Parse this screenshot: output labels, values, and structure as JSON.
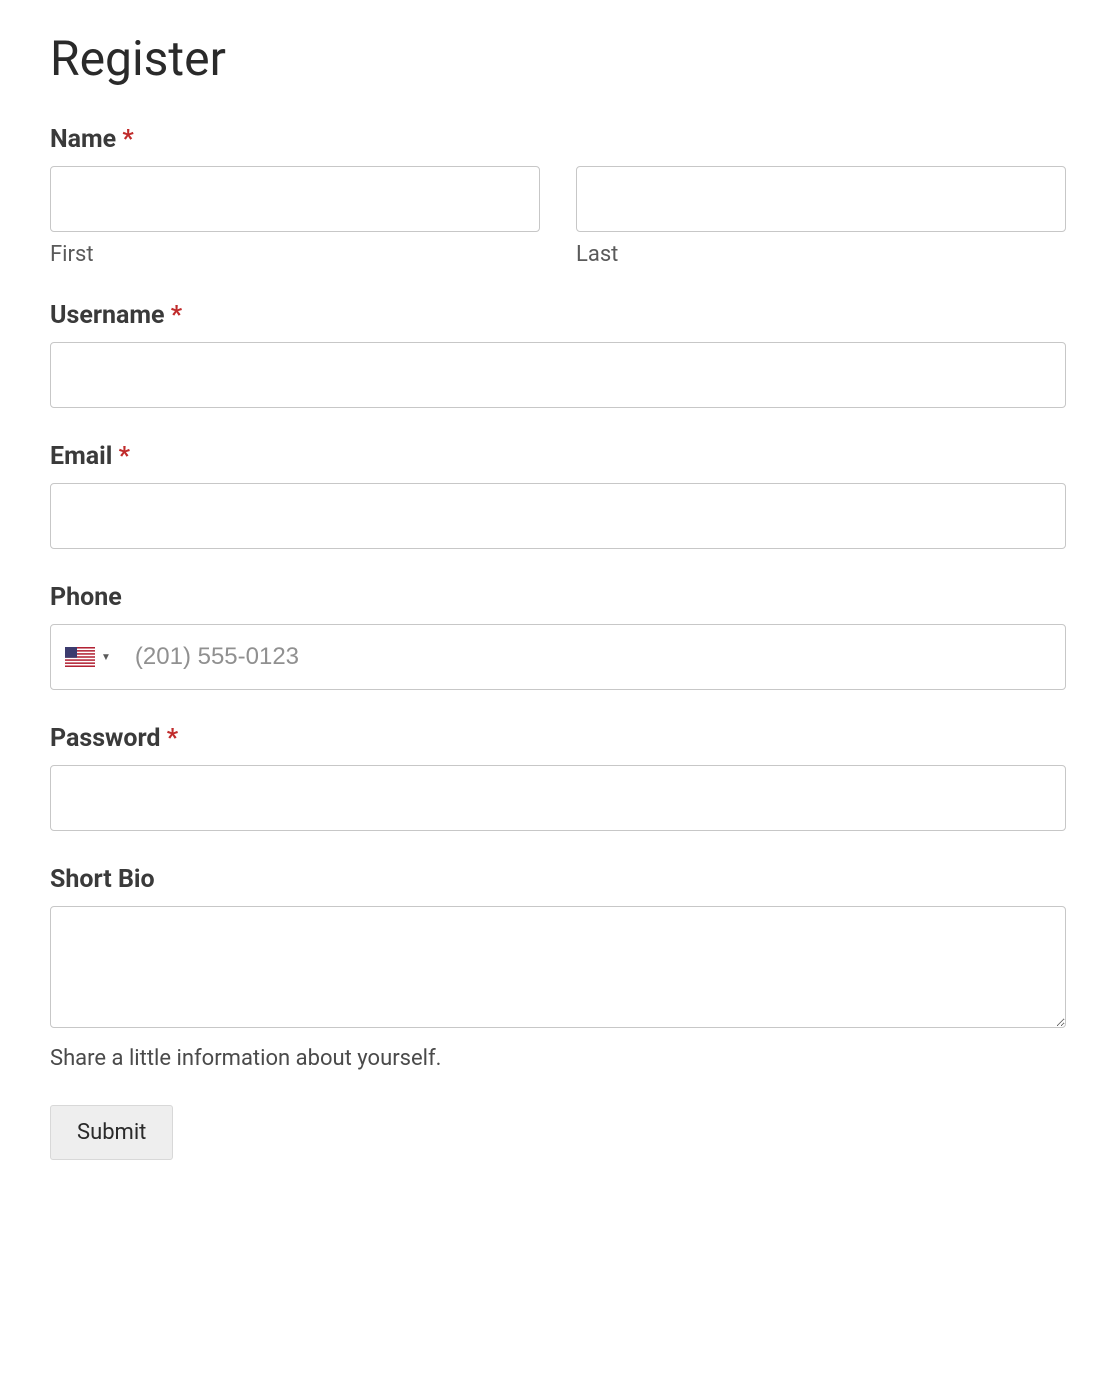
{
  "page": {
    "title": "Register"
  },
  "fields": {
    "name": {
      "label": "Name",
      "required_marker": "*",
      "first_sublabel": "First",
      "last_sublabel": "Last"
    },
    "username": {
      "label": "Username",
      "required_marker": "*"
    },
    "email": {
      "label": "Email",
      "required_marker": "*"
    },
    "phone": {
      "label": "Phone",
      "placeholder": "(201) 555-0123",
      "country_flag": "us"
    },
    "password": {
      "label": "Password",
      "required_marker": "*"
    },
    "bio": {
      "label": "Short Bio",
      "help_text": "Share a little information about yourself."
    }
  },
  "submit": {
    "label": "Submit"
  }
}
